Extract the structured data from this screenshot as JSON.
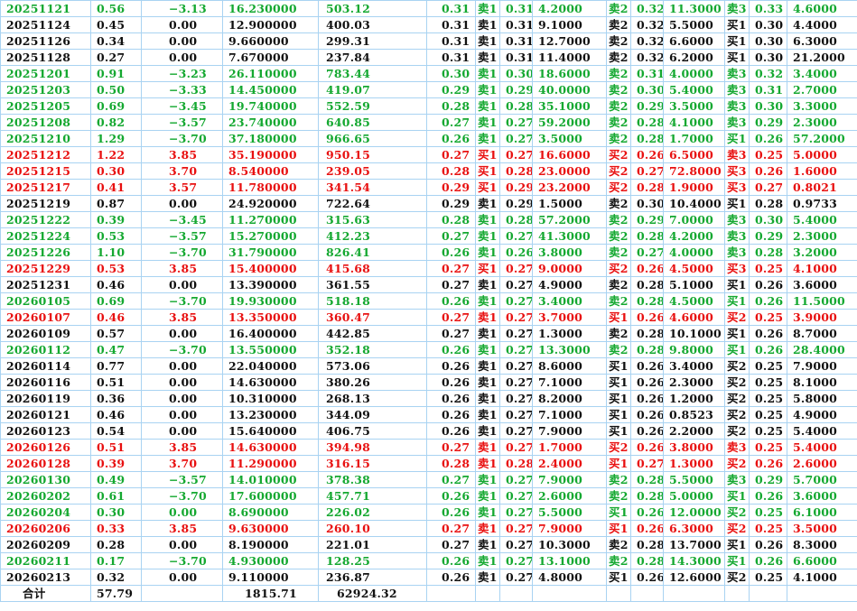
{
  "colors": {
    "up": "#e81010",
    "down": "#14a830",
    "flat": "#101010",
    "grid": "#a9d3f2"
  },
  "rows": [
    {
      "trend": "down",
      "date": "20251121",
      "pct": "0.56",
      "change": "−3.13",
      "vol": "16.230000",
      "amt": "503.12",
      "price": "0.31",
      "a_side": "卖1",
      "a_price": "0.31",
      "a_qty": "4.2000",
      "b_side": "卖2",
      "b_price": "0.32",
      "b_qty": "11.3000",
      "c_side": "卖3",
      "c_price": "0.33",
      "c_qty": "4.6000"
    },
    {
      "trend": "flat",
      "date": "20251124",
      "pct": "0.45",
      "change": "0.00",
      "vol": "12.900000",
      "amt": "400.03",
      "price": "0.31",
      "a_side": "卖1",
      "a_price": "0.31",
      "a_qty": "9.1000",
      "b_side": "卖2",
      "b_price": "0.32",
      "b_qty": "5.5000",
      "c_side": "买1",
      "c_price": "0.30",
      "c_qty": "4.4000"
    },
    {
      "trend": "flat",
      "date": "20251126",
      "pct": "0.34",
      "change": "0.00",
      "vol": "9.660000",
      "amt": "299.31",
      "price": "0.31",
      "a_side": "卖1",
      "a_price": "0.31",
      "a_qty": "12.7000",
      "b_side": "卖2",
      "b_price": "0.32",
      "b_qty": "6.6000",
      "c_side": "买1",
      "c_price": "0.30",
      "c_qty": "6.3000"
    },
    {
      "trend": "flat",
      "date": "20251128",
      "pct": "0.27",
      "change": "0.00",
      "vol": "7.670000",
      "amt": "237.84",
      "price": "0.31",
      "a_side": "卖1",
      "a_price": "0.31",
      "a_qty": "11.4000",
      "b_side": "卖2",
      "b_price": "0.32",
      "b_qty": "6.2000",
      "c_side": "买1",
      "c_price": "0.30",
      "c_qty": "21.2000"
    },
    {
      "trend": "down",
      "date": "20251201",
      "pct": "0.91",
      "change": "−3.23",
      "vol": "26.110000",
      "amt": "783.44",
      "price": "0.30",
      "a_side": "卖1",
      "a_price": "0.30",
      "a_qty": "18.6000",
      "b_side": "卖2",
      "b_price": "0.31",
      "b_qty": "4.0000",
      "c_side": "卖3",
      "c_price": "0.32",
      "c_qty": "3.4000"
    },
    {
      "trend": "down",
      "date": "20251203",
      "pct": "0.50",
      "change": "−3.33",
      "vol": "14.450000",
      "amt": "419.07",
      "price": "0.29",
      "a_side": "卖1",
      "a_price": "0.29",
      "a_qty": "40.0000",
      "b_side": "卖2",
      "b_price": "0.30",
      "b_qty": "5.4000",
      "c_side": "卖3",
      "c_price": "0.31",
      "c_qty": "2.7000"
    },
    {
      "trend": "down",
      "date": "20251205",
      "pct": "0.69",
      "change": "−3.45",
      "vol": "19.740000",
      "amt": "552.59",
      "price": "0.28",
      "a_side": "卖1",
      "a_price": "0.28",
      "a_qty": "35.1000",
      "b_side": "卖2",
      "b_price": "0.29",
      "b_qty": "3.5000",
      "c_side": "卖3",
      "c_price": "0.30",
      "c_qty": "3.3000"
    },
    {
      "trend": "down",
      "date": "20251208",
      "pct": "0.82",
      "change": "−3.57",
      "vol": "23.740000",
      "amt": "640.85",
      "price": "0.27",
      "a_side": "卖1",
      "a_price": "0.27",
      "a_qty": "59.2000",
      "b_side": "卖2",
      "b_price": "0.28",
      "b_qty": "4.1000",
      "c_side": "卖3",
      "c_price": "0.29",
      "c_qty": "2.3000"
    },
    {
      "trend": "down",
      "date": "20251210",
      "pct": "1.29",
      "change": "−3.70",
      "vol": "37.180000",
      "amt": "966.65",
      "price": "0.26",
      "a_side": "卖1",
      "a_price": "0.27",
      "a_qty": "3.5000",
      "b_side": "卖2",
      "b_price": "0.28",
      "b_qty": "1.7000",
      "c_side": "买1",
      "c_price": "0.26",
      "c_qty": "57.2000"
    },
    {
      "trend": "up",
      "date": "20251212",
      "pct": "1.22",
      "change": "3.85",
      "vol": "35.190000",
      "amt": "950.15",
      "price": "0.27",
      "a_side": "买1",
      "a_price": "0.27",
      "a_qty": "16.6000",
      "b_side": "买2",
      "b_price": "0.26",
      "b_qty": "6.5000",
      "c_side": "卖3",
      "c_price": "0.25",
      "c_qty": "5.0000"
    },
    {
      "trend": "up",
      "date": "20251215",
      "pct": "0.30",
      "change": "3.70",
      "vol": "8.540000",
      "amt": "239.05",
      "price": "0.28",
      "a_side": "买1",
      "a_price": "0.28",
      "a_qty": "23.0000",
      "b_side": "买2",
      "b_price": "0.27",
      "b_qty": "72.8000",
      "c_side": "买3",
      "c_price": "0.26",
      "c_qty": "1.6000"
    },
    {
      "trend": "up",
      "date": "20251217",
      "pct": "0.41",
      "change": "3.57",
      "vol": "11.780000",
      "amt": "341.54",
      "price": "0.29",
      "a_side": "买1",
      "a_price": "0.29",
      "a_qty": "23.2000",
      "b_side": "买2",
      "b_price": "0.28",
      "b_qty": "1.9000",
      "c_side": "买3",
      "c_price": "0.27",
      "c_qty": "0.8021"
    },
    {
      "trend": "flat",
      "date": "20251219",
      "pct": "0.87",
      "change": "0.00",
      "vol": "24.920000",
      "amt": "722.64",
      "price": "0.29",
      "a_side": "卖1",
      "a_price": "0.29",
      "a_qty": "1.5000",
      "b_side": "卖2",
      "b_price": "0.30",
      "b_qty": "10.4000",
      "c_side": "买1",
      "c_price": "0.28",
      "c_qty": "0.9733"
    },
    {
      "trend": "down",
      "date": "20251222",
      "pct": "0.39",
      "change": "−3.45",
      "vol": "11.270000",
      "amt": "315.63",
      "price": "0.28",
      "a_side": "卖1",
      "a_price": "0.28",
      "a_qty": "57.2000",
      "b_side": "卖2",
      "b_price": "0.29",
      "b_qty": "7.0000",
      "c_side": "卖3",
      "c_price": "0.30",
      "c_qty": "5.4000"
    },
    {
      "trend": "down",
      "date": "20251224",
      "pct": "0.53",
      "change": "−3.57",
      "vol": "15.270000",
      "amt": "412.23",
      "price": "0.27",
      "a_side": "卖1",
      "a_price": "0.27",
      "a_qty": "41.3000",
      "b_side": "卖2",
      "b_price": "0.28",
      "b_qty": "4.2000",
      "c_side": "卖3",
      "c_price": "0.29",
      "c_qty": "2.3000"
    },
    {
      "trend": "down",
      "date": "20251226",
      "pct": "1.10",
      "change": "−3.70",
      "vol": "31.790000",
      "amt": "826.41",
      "price": "0.26",
      "a_side": "卖1",
      "a_price": "0.26",
      "a_qty": "3.8000",
      "b_side": "卖2",
      "b_price": "0.27",
      "b_qty": "4.0000",
      "c_side": "卖3",
      "c_price": "0.28",
      "c_qty": "3.2000"
    },
    {
      "trend": "up",
      "date": "20251229",
      "pct": "0.53",
      "change": "3.85",
      "vol": "15.400000",
      "amt": "415.68",
      "price": "0.27",
      "a_side": "买1",
      "a_price": "0.27",
      "a_qty": "9.0000",
      "b_side": "买2",
      "b_price": "0.26",
      "b_qty": "4.5000",
      "c_side": "买3",
      "c_price": "0.25",
      "c_qty": "4.1000"
    },
    {
      "trend": "flat",
      "date": "20251231",
      "pct": "0.46",
      "change": "0.00",
      "vol": "13.390000",
      "amt": "361.55",
      "price": "0.27",
      "a_side": "卖1",
      "a_price": "0.27",
      "a_qty": "4.9000",
      "b_side": "卖2",
      "b_price": "0.28",
      "b_qty": "5.1000",
      "c_side": "买1",
      "c_price": "0.26",
      "c_qty": "3.6000"
    },
    {
      "trend": "down",
      "date": "20260105",
      "pct": "0.69",
      "change": "−3.70",
      "vol": "19.930000",
      "amt": "518.18",
      "price": "0.26",
      "a_side": "卖1",
      "a_price": "0.27",
      "a_qty": "3.4000",
      "b_side": "卖2",
      "b_price": "0.28",
      "b_qty": "4.5000",
      "c_side": "买1",
      "c_price": "0.26",
      "c_qty": "11.5000"
    },
    {
      "trend": "up",
      "date": "20260107",
      "pct": "0.46",
      "change": "3.85",
      "vol": "13.350000",
      "amt": "360.47",
      "price": "0.27",
      "a_side": "卖1",
      "a_price": "0.27",
      "a_qty": "3.7000",
      "b_side": "买1",
      "b_price": "0.26",
      "b_qty": "4.6000",
      "c_side": "买2",
      "c_price": "0.25",
      "c_qty": "3.9000"
    },
    {
      "trend": "flat",
      "date": "20260109",
      "pct": "0.57",
      "change": "0.00",
      "vol": "16.400000",
      "amt": "442.85",
      "price": "0.27",
      "a_side": "卖1",
      "a_price": "0.27",
      "a_qty": "1.3000",
      "b_side": "卖2",
      "b_price": "0.28",
      "b_qty": "10.1000",
      "c_side": "买1",
      "c_price": "0.26",
      "c_qty": "8.7000"
    },
    {
      "trend": "down",
      "date": "20260112",
      "pct": "0.47",
      "change": "−3.70",
      "vol": "13.550000",
      "amt": "352.18",
      "price": "0.26",
      "a_side": "卖1",
      "a_price": "0.27",
      "a_qty": "13.3000",
      "b_side": "卖2",
      "b_price": "0.28",
      "b_qty": "9.8000",
      "c_side": "买1",
      "c_price": "0.26",
      "c_qty": "28.4000"
    },
    {
      "trend": "flat",
      "date": "20260114",
      "pct": "0.77",
      "change": "0.00",
      "vol": "22.040000",
      "amt": "573.06",
      "price": "0.26",
      "a_side": "卖1",
      "a_price": "0.27",
      "a_qty": "8.6000",
      "b_side": "买1",
      "b_price": "0.26",
      "b_qty": "3.4000",
      "c_side": "买2",
      "c_price": "0.25",
      "c_qty": "7.9000"
    },
    {
      "trend": "flat",
      "date": "20260116",
      "pct": "0.51",
      "change": "0.00",
      "vol": "14.630000",
      "amt": "380.26",
      "price": "0.26",
      "a_side": "卖1",
      "a_price": "0.27",
      "a_qty": "7.1000",
      "b_side": "买1",
      "b_price": "0.26",
      "b_qty": "2.3000",
      "c_side": "买2",
      "c_price": "0.25",
      "c_qty": "8.1000"
    },
    {
      "trend": "flat",
      "date": "20260119",
      "pct": "0.36",
      "change": "0.00",
      "vol": "10.310000",
      "amt": "268.13",
      "price": "0.26",
      "a_side": "卖1",
      "a_price": "0.27",
      "a_qty": "8.2000",
      "b_side": "买1",
      "b_price": "0.26",
      "b_qty": "1.2000",
      "c_side": "买2",
      "c_price": "0.25",
      "c_qty": "5.8000"
    },
    {
      "trend": "flat",
      "date": "20260121",
      "pct": "0.46",
      "change": "0.00",
      "vol": "13.230000",
      "amt": "344.09",
      "price": "0.26",
      "a_side": "卖1",
      "a_price": "0.27",
      "a_qty": "7.1000",
      "b_side": "买1",
      "b_price": "0.26",
      "b_qty": "0.8523",
      "c_side": "买2",
      "c_price": "0.25",
      "c_qty": "4.9000"
    },
    {
      "trend": "flat",
      "date": "20260123",
      "pct": "0.54",
      "change": "0.00",
      "vol": "15.640000",
      "amt": "406.75",
      "price": "0.26",
      "a_side": "卖1",
      "a_price": "0.27",
      "a_qty": "7.9000",
      "b_side": "买1",
      "b_price": "0.26",
      "b_qty": "2.2000",
      "c_side": "买2",
      "c_price": "0.25",
      "c_qty": "5.4000"
    },
    {
      "trend": "up",
      "date": "20260126",
      "pct": "0.51",
      "change": "3.85",
      "vol": "14.630000",
      "amt": "394.98",
      "price": "0.27",
      "a_side": "卖1",
      "a_price": "0.27",
      "a_qty": "1.7000",
      "b_side": "买2",
      "b_price": "0.26",
      "b_qty": "3.8000",
      "c_side": "卖3",
      "c_price": "0.25",
      "c_qty": "5.4000"
    },
    {
      "trend": "up",
      "date": "20260128",
      "pct": "0.39",
      "change": "3.70",
      "vol": "11.290000",
      "amt": "316.15",
      "price": "0.28",
      "a_side": "卖1",
      "a_price": "0.28",
      "a_qty": "2.4000",
      "b_side": "买1",
      "b_price": "0.27",
      "b_qty": "1.3000",
      "c_side": "买2",
      "c_price": "0.26",
      "c_qty": "2.6000"
    },
    {
      "trend": "down",
      "date": "20260130",
      "pct": "0.49",
      "change": "−3.57",
      "vol": "14.010000",
      "amt": "378.38",
      "price": "0.27",
      "a_side": "卖1",
      "a_price": "0.27",
      "a_qty": "7.9000",
      "b_side": "卖2",
      "b_price": "0.28",
      "b_qty": "5.5000",
      "c_side": "卖3",
      "c_price": "0.29",
      "c_qty": "5.7000"
    },
    {
      "trend": "down",
      "date": "20260202",
      "pct": "0.61",
      "change": "−3.70",
      "vol": "17.600000",
      "amt": "457.71",
      "price": "0.26",
      "a_side": "卖1",
      "a_price": "0.27",
      "a_qty": "2.6000",
      "b_side": "卖2",
      "b_price": "0.28",
      "b_qty": "5.0000",
      "c_side": "买1",
      "c_price": "0.26",
      "c_qty": "3.6000"
    },
    {
      "trend": "down",
      "date": "20260204",
      "pct": "0.30",
      "change": "0.00",
      "vol": "8.690000",
      "amt": "226.02",
      "price": "0.26",
      "a_side": "卖1",
      "a_price": "0.27",
      "a_qty": "5.5000",
      "b_side": "买1",
      "b_price": "0.26",
      "b_qty": "12.0000",
      "c_side": "买2",
      "c_price": "0.25",
      "c_qty": "6.1000"
    },
    {
      "trend": "up",
      "date": "20260206",
      "pct": "0.33",
      "change": "3.85",
      "vol": "9.630000",
      "amt": "260.10",
      "price": "0.27",
      "a_side": "卖1",
      "a_price": "0.27",
      "a_qty": "7.9000",
      "b_side": "买1",
      "b_price": "0.26",
      "b_qty": "6.3000",
      "c_side": "买2",
      "c_price": "0.25",
      "c_qty": "3.5000"
    },
    {
      "trend": "flat",
      "date": "20260209",
      "pct": "0.28",
      "change": "0.00",
      "vol": "8.190000",
      "amt": "221.01",
      "price": "0.27",
      "a_side": "卖1",
      "a_price": "0.27",
      "a_qty": "10.3000",
      "b_side": "卖2",
      "b_price": "0.28",
      "b_qty": "13.7000",
      "c_side": "买1",
      "c_price": "0.26",
      "c_qty": "8.3000"
    },
    {
      "trend": "down",
      "date": "20260211",
      "pct": "0.17",
      "change": "−3.70",
      "vol": "4.930000",
      "amt": "128.25",
      "price": "0.26",
      "a_side": "卖1",
      "a_price": "0.27",
      "a_qty": "13.1000",
      "b_side": "卖2",
      "b_price": "0.28",
      "b_qty": "14.3000",
      "c_side": "买1",
      "c_price": "0.26",
      "c_qty": "6.6000"
    },
    {
      "trend": "flat",
      "date": "20260213",
      "pct": "0.32",
      "change": "0.00",
      "vol": "9.110000",
      "amt": "236.87",
      "price": "0.26",
      "a_side": "卖1",
      "a_price": "0.27",
      "a_qty": "4.8000",
      "b_side": "买1",
      "b_price": "0.26",
      "b_qty": "12.6000",
      "c_side": "买2",
      "c_price": "0.25",
      "c_qty": "4.1000"
    }
  ],
  "total": {
    "label": "合计",
    "pct": "57.79",
    "vol": "1815.71",
    "amt": "62924.32"
  }
}
